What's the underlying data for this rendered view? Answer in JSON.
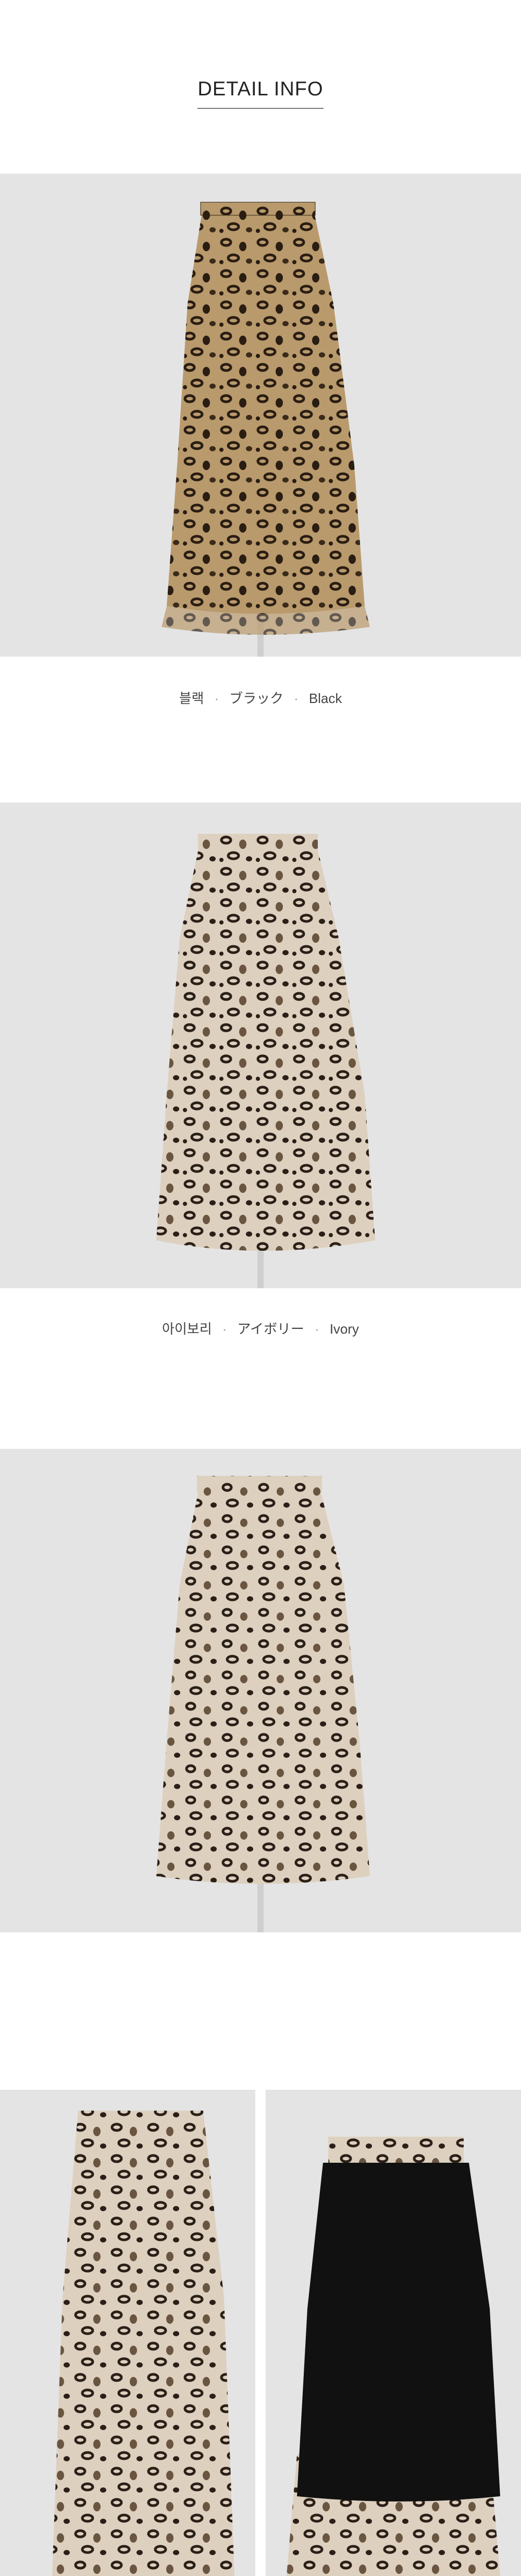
{
  "header": {
    "title": "DETAIL INFO"
  },
  "colors": {
    "background": "#e3e3e3",
    "leopard_base": "#c8a97c",
    "leopard_spot": "#2b1f15",
    "ivory_base": "#ddd0c0",
    "black_lining": "#111111"
  },
  "sections": [
    {
      "photo": "skirt-photo-black",
      "caption": {
        "ko": "블랙",
        "ja": "ブラック",
        "en": "Black",
        "sep": "·"
      }
    },
    {
      "photo": "skirt-photo-ivory",
      "caption": {
        "ko": "아이보리",
        "ja": "アイボリー",
        "en": "Ivory",
        "sep": "·"
      }
    },
    {
      "photo": "skirt-photo-ivory-2",
      "caption": null
    }
  ],
  "details": [
    {
      "name": "skirt-detail-front"
    },
    {
      "name": "skirt-detail-lining"
    }
  ]
}
